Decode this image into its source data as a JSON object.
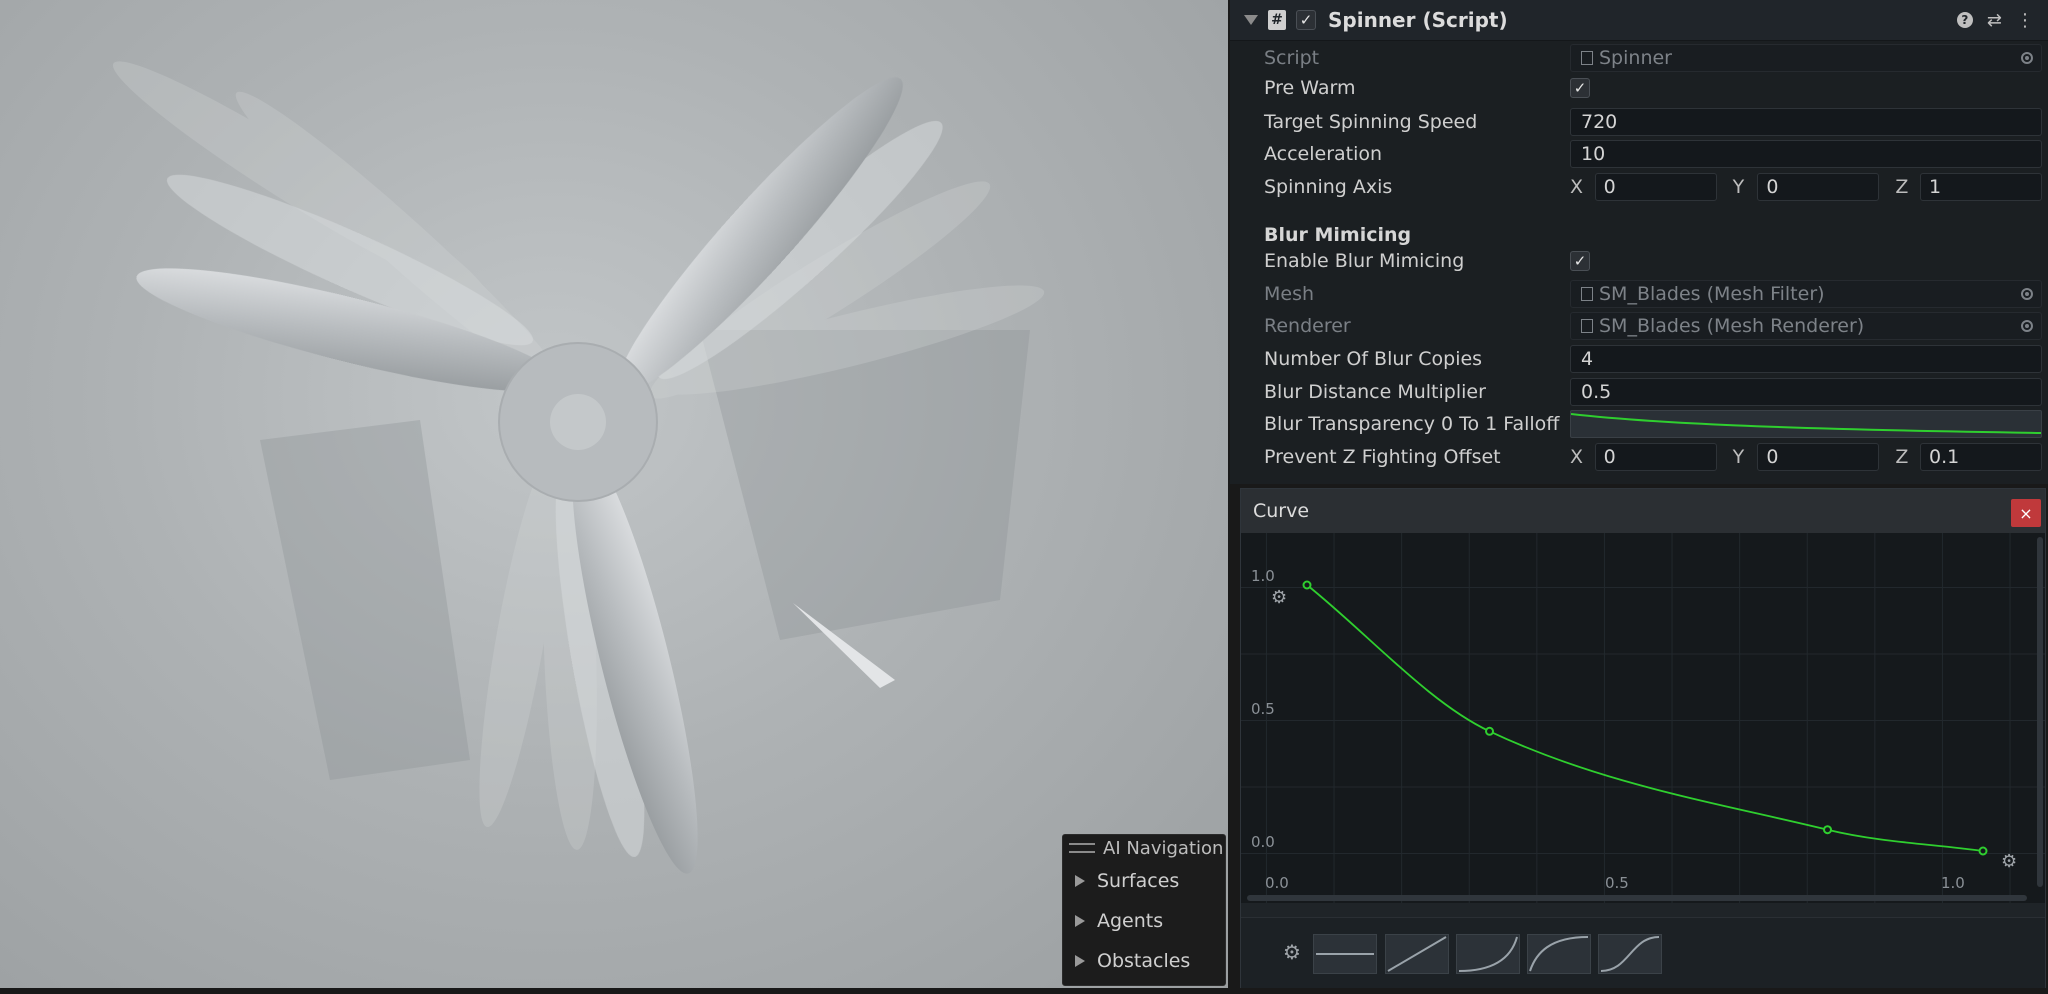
{
  "inspector": {
    "component_title": "Spinner (Script)",
    "script_label": "Script",
    "script_value": "Spinner",
    "pre_warm_label": "Pre Warm",
    "target_speed_label": "Target Spinning Speed",
    "target_speed_value": "720",
    "acceleration_label": "Acceleration",
    "acceleration_value": "10",
    "spinning_axis_label": "Spinning Axis",
    "spinning_axis": {
      "x_label": "X",
      "x": "0",
      "y_label": "Y",
      "y": "0",
      "z_label": "Z",
      "z": "1"
    },
    "blur_section_title": "Blur Mimicing",
    "enable_blur_label": "Enable Blur Mimicing",
    "mesh_label": "Mesh",
    "mesh_value": "SM_Blades (Mesh Filter)",
    "renderer_label": "Renderer",
    "renderer_value": "SM_Blades (Mesh Renderer)",
    "blur_copies_label": "Number Of Blur Copies",
    "blur_copies_value": "4",
    "blur_distance_label": "Blur Distance Multiplier",
    "blur_distance_value": "0.5",
    "blur_transparency_label": "Blur Transparency 0 To 1 Falloff",
    "z_fight_label": "Prevent Z Fighting Offset",
    "z_fight": {
      "x_label": "X",
      "x": "0",
      "y_label": "Y",
      "y": "0",
      "z_label": "Z",
      "z": "0.1"
    },
    "pre_warm_checked": true,
    "enable_blur_checked": true,
    "component_enabled": true
  },
  "curve_window": {
    "title": "Curve",
    "close_label": "×",
    "y_ticks": [
      "1.0",
      "0.5",
      "0.0"
    ],
    "x_ticks": [
      "0.0",
      "0.5",
      "1.0"
    ],
    "curve_color": "#2fcf2f",
    "keys": [
      {
        "time": 0.0,
        "value": 1.0
      },
      {
        "time": 0.27,
        "value": 0.45
      },
      {
        "time": 0.77,
        "value": 0.08
      },
      {
        "time": 1.0,
        "value": 0.0
      }
    ]
  },
  "ai_navigation": {
    "title": "AI Navigation",
    "items": [
      "Surfaces",
      "Agents",
      "Obstacles"
    ]
  },
  "icons": {
    "script": "script-icon",
    "help": "help-icon",
    "presets": "presets-icon",
    "menu": "kebab-menu-icon",
    "gear": "gear-icon"
  }
}
